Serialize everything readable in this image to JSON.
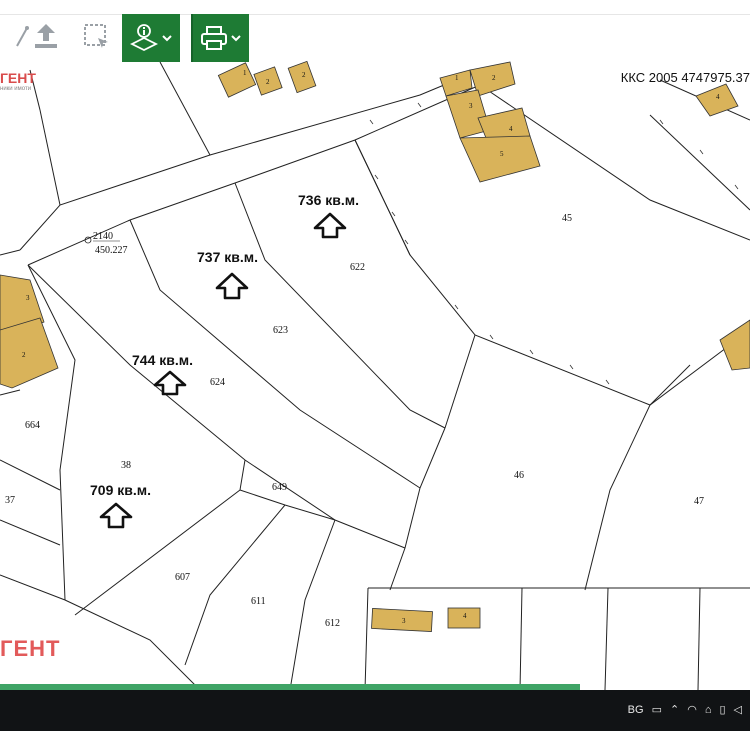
{
  "toolbar": {
    "tools": [
      "measure-icon",
      "upload-icon",
      "select-area-icon"
    ],
    "green_buttons": [
      "layers-info-icon",
      "print-icon"
    ]
  },
  "header": {
    "crs_label": "ККС 2005 4747975.37"
  },
  "logo": {
    "top_text": "ГЕНТ",
    "top_subtext": "ники имоти",
    "bottom_text": "ГЕНТ"
  },
  "map": {
    "areas": [
      {
        "id": "area-736",
        "label": "736 кв.м."
      },
      {
        "id": "area-737",
        "label": "737 кв.м."
      },
      {
        "id": "area-744",
        "label": "744 кв.м."
      },
      {
        "id": "area-709",
        "label": "709 кв.м."
      }
    ],
    "parcels": [
      "622",
      "623",
      "624",
      "664",
      "38",
      "37",
      "649",
      "607",
      "611",
      "612",
      "45",
      "46",
      "47"
    ],
    "point": {
      "code": "2140",
      "elevation": "450.227"
    },
    "buildings": [
      "1",
      "2",
      "2",
      "1",
      "2",
      "3",
      "4",
      "5",
      "4",
      "3",
      "2",
      "3",
      "4"
    ]
  },
  "taskbar": {
    "lang": "BG"
  },
  "colors": {
    "building_fill": "#d9b35a",
    "toolbar_green": "#1e7b34",
    "line": "#222222"
  }
}
